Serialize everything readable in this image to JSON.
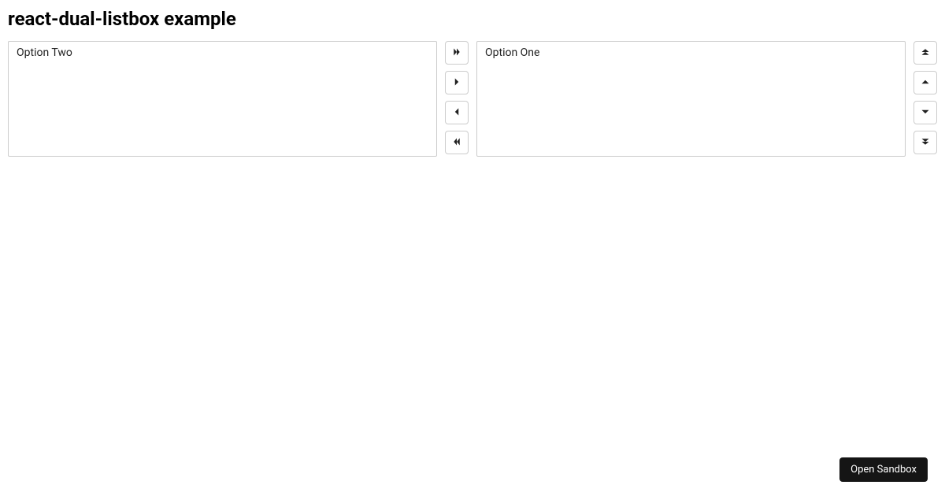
{
  "title": "react-dual-listbox example",
  "available": {
    "options": [
      "Option Two"
    ]
  },
  "selected": {
    "options": [
      "Option One"
    ]
  },
  "footer": {
    "open_sandbox": "Open Sandbox"
  }
}
